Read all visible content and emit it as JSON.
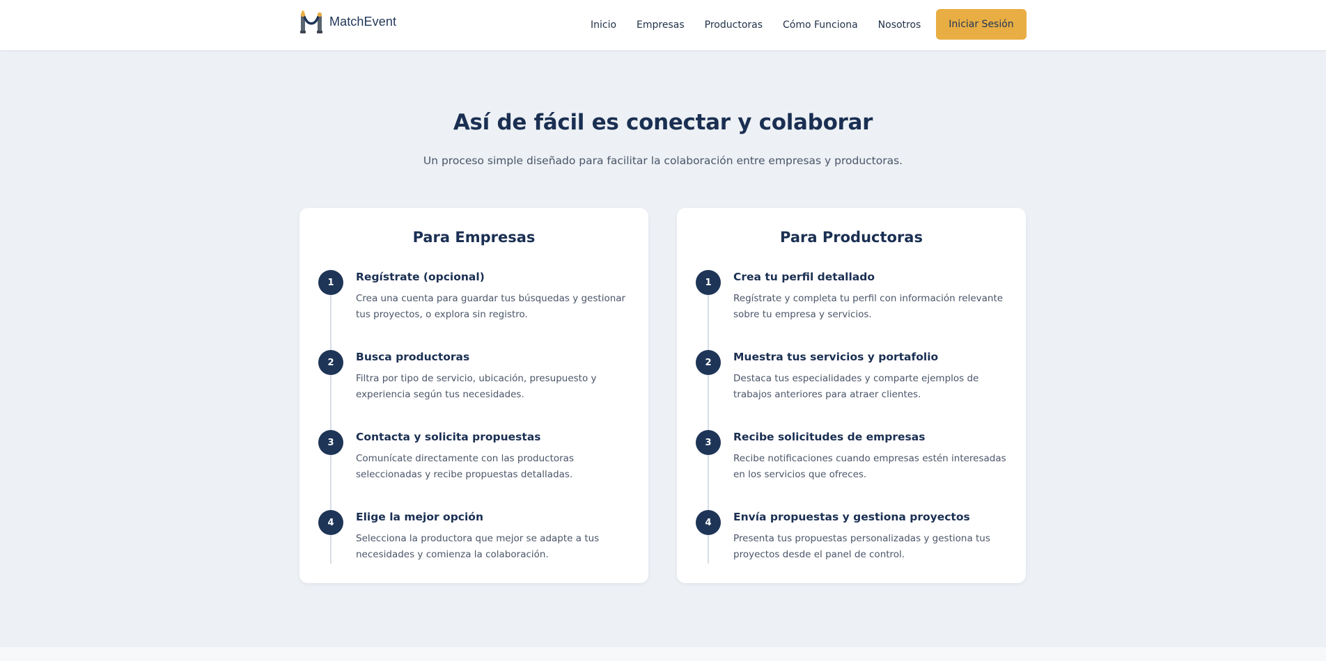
{
  "brand": {
    "name": "MatchEvent"
  },
  "nav": {
    "items": [
      "Inicio",
      "Empresas",
      "Productoras",
      "Cómo Funciona",
      "Nosotros"
    ],
    "login_label": "Iniciar Sesión"
  },
  "section": {
    "title": "Así de fácil es conectar y colaborar",
    "subtitle": "Un proceso simple diseñado para facilitar la colaboración entre empresas y productoras."
  },
  "cards": [
    {
      "title": "Para Empresas",
      "steps": [
        {
          "num": "1",
          "title": "Regístrate (opcional)",
          "desc": "Crea una cuenta para guardar tus búsquedas y gestionar tus proyectos, o explora sin registro."
        },
        {
          "num": "2",
          "title": "Busca productoras",
          "desc": "Filtra por tipo de servicio, ubicación, presupuesto y experiencia según tus necesidades."
        },
        {
          "num": "3",
          "title": "Contacta y solicita propuestas",
          "desc": "Comunícate directamente con las productoras seleccionadas y recibe propuestas detalladas."
        },
        {
          "num": "4",
          "title": "Elige la mejor opción",
          "desc": "Selecciona la productora que mejor se adapte a tus necesidades y comienza la colaboración."
        }
      ]
    },
    {
      "title": "Para Productoras",
      "steps": [
        {
          "num": "1",
          "title": "Crea tu perfil detallado",
          "desc": "Regístrate y completa tu perfil con información relevante sobre tu empresa y servicios."
        },
        {
          "num": "2",
          "title": "Muestra tus servicios y portafolio",
          "desc": "Destaca tus especialidades y comparte ejemplos de trabajos anteriores para atraer clientes."
        },
        {
          "num": "3",
          "title": "Recibe solicitudes de empresas",
          "desc": "Recibe notificaciones cuando empresas estén interesadas en los servicios que ofreces."
        },
        {
          "num": "4",
          "title": "Envía propuestas y gestiona proyectos",
          "desc": "Presenta tus propuestas personalizadas y gestiona tus proyectos desde el panel de control."
        }
      ]
    }
  ],
  "colors": {
    "primary": "#1e3557",
    "accent": "#e8ad43",
    "background": "#edf1f5",
    "card": "#ffffff",
    "muted_text": "#4a5568"
  }
}
